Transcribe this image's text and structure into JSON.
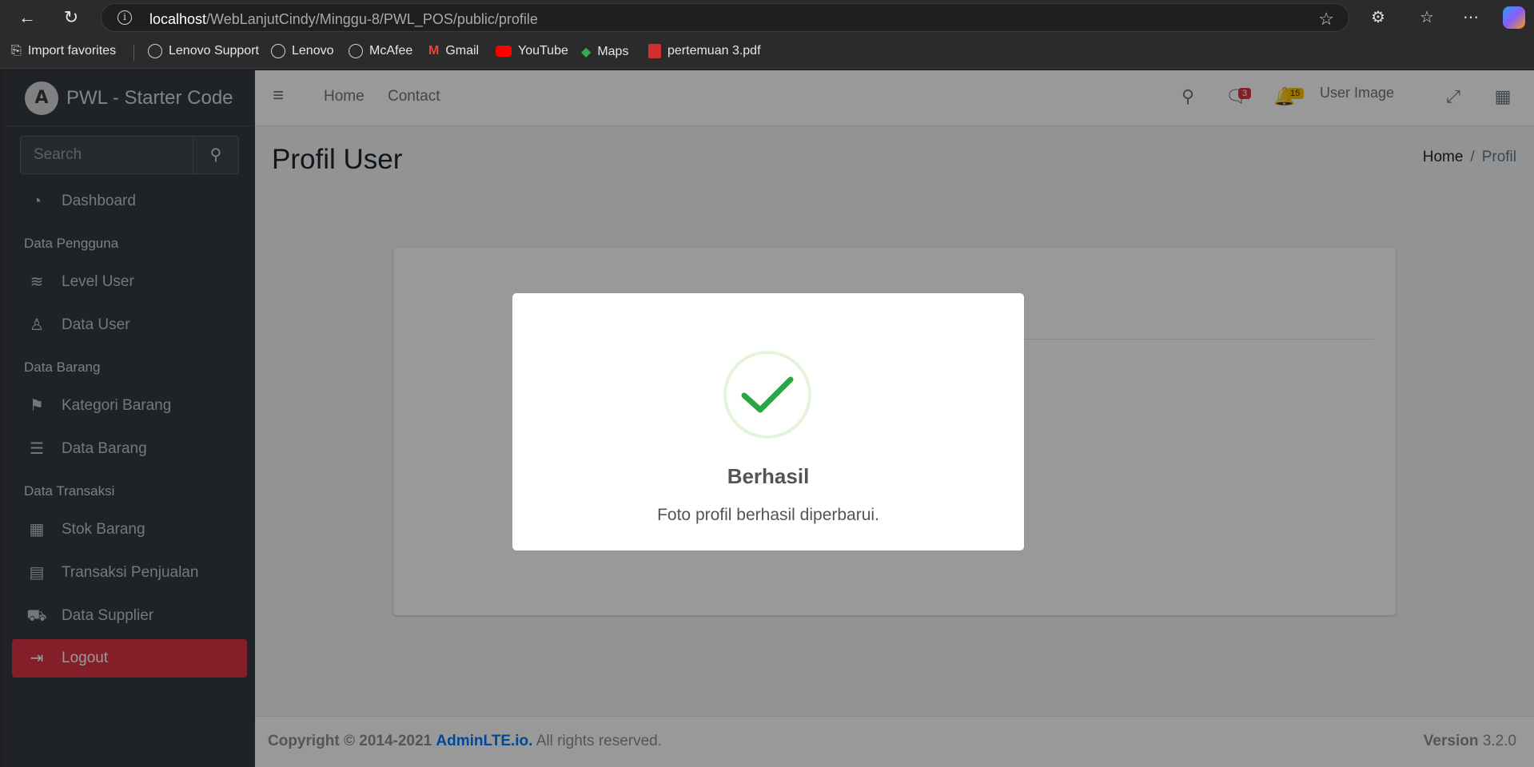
{
  "browser": {
    "url_host": "localhost",
    "url_path": "/WebLanjutCindy/Minggu-8/PWL_POS/public/profile",
    "bookmarks": [
      {
        "label": "Import favorites",
        "icon": "import-icon"
      },
      {
        "label": "Lenovo Support",
        "icon": "globe-icon"
      },
      {
        "label": "Lenovo",
        "icon": "globe-icon"
      },
      {
        "label": "McAfee",
        "icon": "globe-icon"
      },
      {
        "label": "Gmail",
        "icon": "gmail-icon"
      },
      {
        "label": "YouTube",
        "icon": "youtube-icon"
      },
      {
        "label": "Maps",
        "icon": "maps-icon"
      },
      {
        "label": "pertemuan 3.pdf",
        "icon": "pdf-icon"
      }
    ]
  },
  "sidebar": {
    "brand": "PWL - Starter Code",
    "search_placeholder": "Search",
    "dashboard": "Dashboard",
    "header_pengguna": "Data Pengguna",
    "level_user": "Level User",
    "data_user": "Data User",
    "header_barang": "Data Barang",
    "kategori_barang": "Kategori Barang",
    "data_barang": "Data Barang",
    "header_transaksi": "Data Transaksi",
    "stok_barang": "Stok Barang",
    "transaksi_penjualan": "Transaksi Penjualan",
    "data_supplier": "Data Supplier",
    "logout": "Logout"
  },
  "navbar": {
    "home": "Home",
    "contact": "Contact",
    "messages_badge": "3",
    "notifications_badge": "15",
    "user_image_alt": "User Image"
  },
  "content": {
    "title": "Profil User",
    "breadcrumb_home": "Home",
    "breadcrumb_sep": "/",
    "breadcrumb_current": "Profil"
  },
  "footer": {
    "copyright": "Copyright © 2014-2021",
    "brand": "AdminLTE.io.",
    "rights": "All rights reserved.",
    "version_label": "Version",
    "version": "3.2.0"
  },
  "modal": {
    "title": "Berhasil",
    "text": "Foto profil berhasil diperbarui.",
    "icon": "success-check-icon",
    "accent": "#28a745"
  },
  "colors": {
    "sidebar_bg": "#343a40",
    "logout_bg": "#dc3545",
    "link": "#007bff"
  }
}
